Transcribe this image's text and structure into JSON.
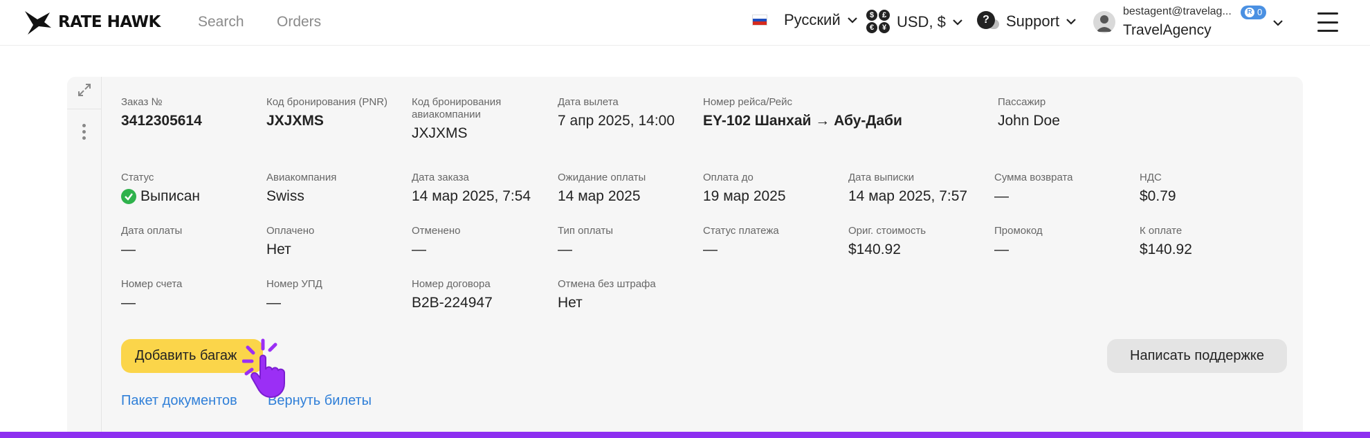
{
  "header": {
    "logo_text": "RATE HAWK",
    "nav": [
      "Search",
      "Orders"
    ],
    "language": "Русский",
    "currency": "USD, $",
    "support": "Support",
    "user_email": "bestagent@travelag...",
    "badge_count": "0",
    "agency": "TravelAgency"
  },
  "order": {
    "row1": [
      {
        "label": "Заказ №",
        "value": "3412305614",
        "bold": true
      },
      {
        "label": "Код бронирования (PNR)",
        "value": "JXJXMS",
        "bold": true
      },
      {
        "label": "Код бронирования авиакомпании",
        "value": "JXJXMS",
        "bold": false
      },
      {
        "label": "Дата вылета",
        "value": "7 апр 2025, 14:00",
        "bold": false
      },
      {
        "label": "Номер рейса/Рейс",
        "value": "EY-102 Шанхай → Абу-Даби",
        "bold": true
      },
      {
        "label": "Пассажир",
        "value": "John Doe",
        "bold": false
      }
    ],
    "row2": [
      {
        "label": "Статус",
        "value": "Выписан"
      },
      {
        "label": "Авиакомпания",
        "value": "Swiss"
      },
      {
        "label": "Дата заказа",
        "value": "14 мар 2025, 7:54"
      },
      {
        "label": "Ожидание оплаты",
        "value": "14 мар 2025"
      },
      {
        "label": "Оплата до",
        "value": "19 мар 2025"
      },
      {
        "label": "Дата выписки",
        "value": "14 мар 2025, 7:57"
      },
      {
        "label": "Сумма возврата",
        "value": "—"
      },
      {
        "label": "НДС",
        "value": "$0.79"
      }
    ],
    "row3": [
      {
        "label": "Дата оплаты",
        "value": "—"
      },
      {
        "label": "Оплачено",
        "value": "Нет"
      },
      {
        "label": "Отменено",
        "value": "—"
      },
      {
        "label": "Тип оплаты",
        "value": "—"
      },
      {
        "label": "Статус платежа",
        "value": "—"
      },
      {
        "label": "Ориг. стоимость",
        "value": "$140.92"
      },
      {
        "label": "Промокод",
        "value": "—"
      },
      {
        "label": "К оплате",
        "value": "$140.92"
      }
    ],
    "row4": [
      {
        "label": "Номер счета",
        "value": "—"
      },
      {
        "label": "Номер УПД",
        "value": "—"
      },
      {
        "label": "Номер договора",
        "value": "B2B-224947"
      },
      {
        "label": "Отмена без штрафа",
        "value": "Нет"
      }
    ]
  },
  "actions": {
    "add_baggage": "Добавить багаж",
    "write_support": "Написать поддержке",
    "doc_package": "Пакет документов",
    "return_tickets": "Вернуть билеты"
  },
  "colors": {
    "accent_yellow": "#fbd54a",
    "link_blue": "#2f7fd8",
    "bottom_bar": "#8d2ff0",
    "status_green": "#2fb24c"
  }
}
